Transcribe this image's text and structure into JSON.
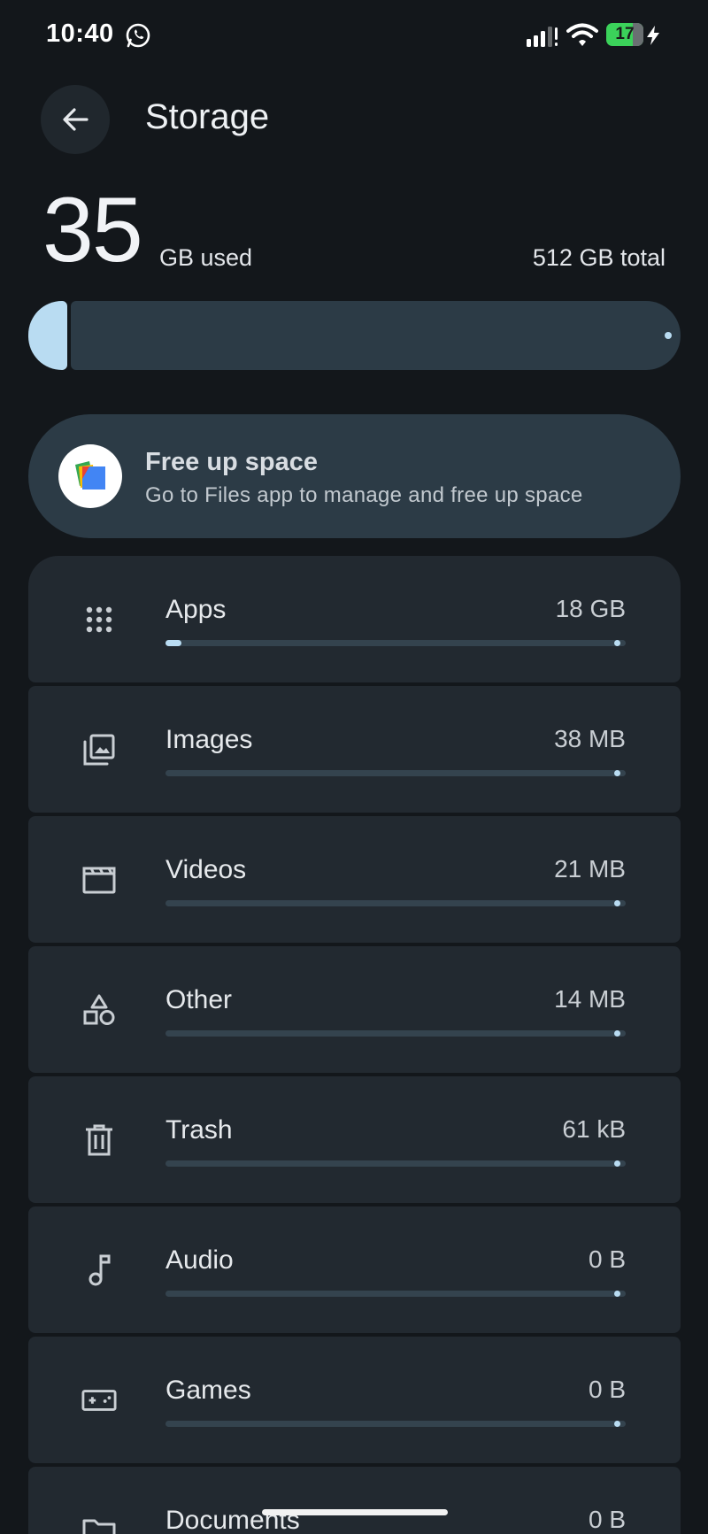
{
  "status_bar": {
    "time": "10:40",
    "battery_level": "17",
    "icons": [
      "whatsapp-icon",
      "signal-icon",
      "wifi-icon",
      "battery-icon",
      "charging-bolt-icon"
    ]
  },
  "header": {
    "title": "Storage",
    "back_icon": "arrow-back-icon"
  },
  "summary": {
    "used_value": "35",
    "used_label": "GB used",
    "total_label": "512 GB total",
    "used_fraction": 0.068
  },
  "free_up": {
    "title": "Free up space",
    "subtitle": "Go to Files app to manage and free up space",
    "icon": "files-app-icon"
  },
  "categories": [
    {
      "name": "Apps",
      "size": "18 GB",
      "icon": "apps-grid-icon",
      "fraction": 0.035
    },
    {
      "name": "Images",
      "size": "38 MB",
      "icon": "images-icon",
      "fraction": 0
    },
    {
      "name": "Videos",
      "size": "21 MB",
      "icon": "videos-icon",
      "fraction": 0
    },
    {
      "name": "Other",
      "size": "14 MB",
      "icon": "shapes-icon",
      "fraction": 0
    },
    {
      "name": "Trash",
      "size": "61 kB",
      "icon": "trash-icon",
      "fraction": 0
    },
    {
      "name": "Audio",
      "size": "0 B",
      "icon": "music-note-icon",
      "fraction": 0
    },
    {
      "name": "Games",
      "size": "0 B",
      "icon": "gamepad-icon",
      "fraction": 0
    },
    {
      "name": "Documents",
      "size": "0 B",
      "icon": "folder-icon",
      "fraction": 0
    }
  ],
  "colors": {
    "background": "#13171b",
    "card": "#222930",
    "accent": "#b9dcf2",
    "track": "#2c3b46"
  }
}
